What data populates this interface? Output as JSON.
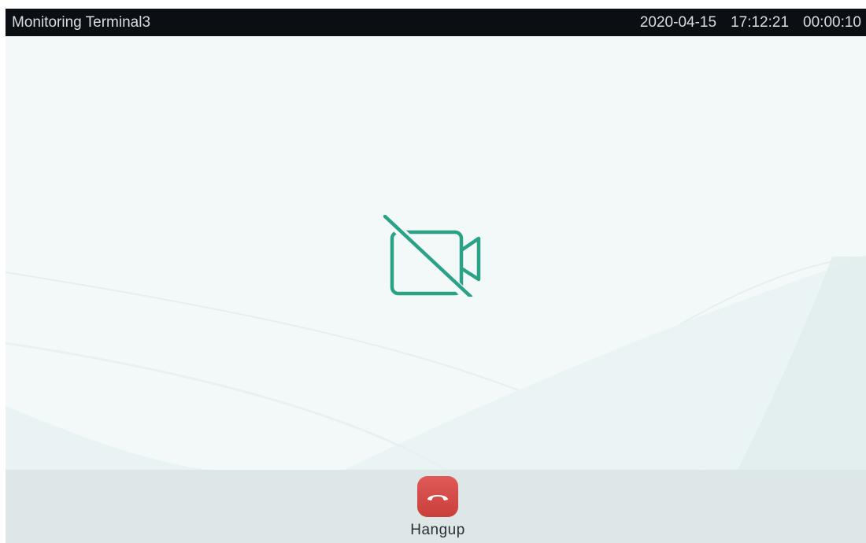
{
  "topbar": {
    "title": "Monitoring Terminal3",
    "date": "2020-04-15",
    "time": "17:12:21",
    "duration": "00:00:10"
  },
  "video": {
    "status_icon": "camera-off-icon",
    "icon_color": "#2aa286"
  },
  "controls": {
    "hangup_label": "Hangup",
    "hangup_icon": "phone-hangup-icon",
    "hangup_color": "#d94c49"
  }
}
